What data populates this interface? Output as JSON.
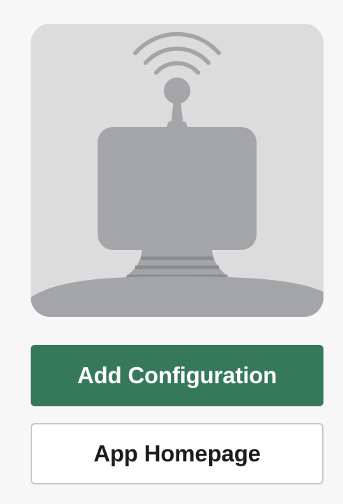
{
  "app_icon": {
    "icon": "broadcast-robot-icon",
    "colors": {
      "background": "#dcdcdc",
      "figure": "#a3a5a8",
      "stripes": "#8a8c8f"
    }
  },
  "actions": {
    "add_configuration_label": "Add Configuration",
    "app_homepage_label": "App Homepage"
  },
  "colors": {
    "primary_button": "#35785a",
    "secondary_button_border": "#c7c7c7",
    "page_background": "#f7f7f7"
  }
}
